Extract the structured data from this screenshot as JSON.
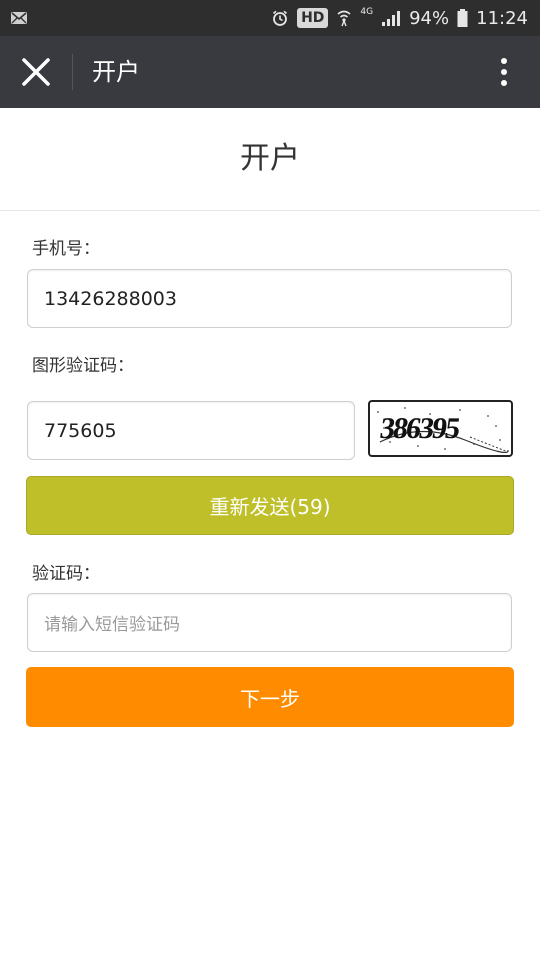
{
  "status_bar": {
    "hd": "HD",
    "network": "4G",
    "battery": "94%",
    "time": "11:24"
  },
  "title_bar": {
    "title": "开户"
  },
  "page": {
    "heading": "开户"
  },
  "form": {
    "phone_label": "手机号：",
    "phone_value": "13426288003",
    "captcha_label": "图形验证码：",
    "captcha_value": "775605",
    "captcha_image_text": "386395",
    "resend_label": "重新发送(59)",
    "sms_label": "验证码：",
    "sms_placeholder": "请输入短信验证码",
    "next_label": "下一步"
  },
  "colors": {
    "status_bar": "#2e2e2e",
    "title_bar": "#393a3f",
    "resend_button": "#bfbf2a",
    "next_button": "#ff8c00"
  },
  "icons": {
    "mail": "mail-icon",
    "alarm": "alarm-icon",
    "wifi": "wifi-icon",
    "signal": "signal-icon",
    "battery": "battery-icon",
    "close": "close-icon",
    "menu": "more-vertical-icon"
  }
}
